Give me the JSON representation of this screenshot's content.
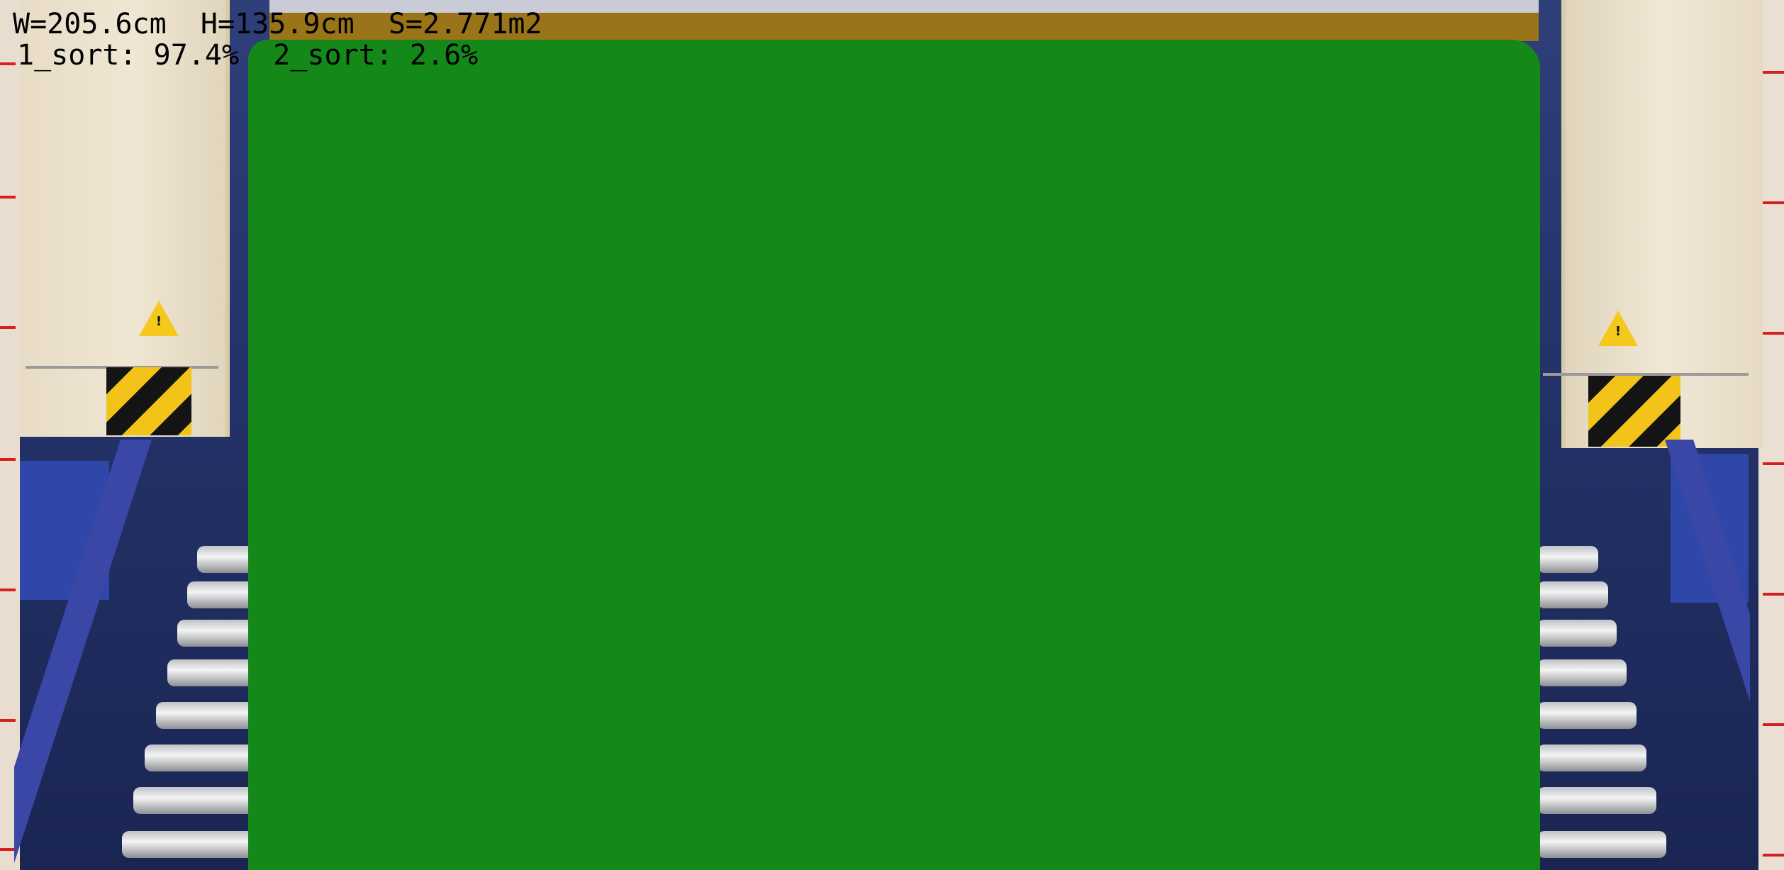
{
  "overlay": {
    "width_text": "W=205.6cm",
    "height_text": "H=135.9cm",
    "area_text": "S=2.771m2",
    "sort1_text": "1_sort: 97.4%",
    "sort2_text": "2_sort: 2.6%"
  },
  "colors": {
    "detected_region": "#14891a",
    "top_band": "#9a7418",
    "text": "#000000"
  },
  "icons": {
    "warning_left": "warning-triangle-icon",
    "warning_right": "warning-triangle-icon"
  }
}
